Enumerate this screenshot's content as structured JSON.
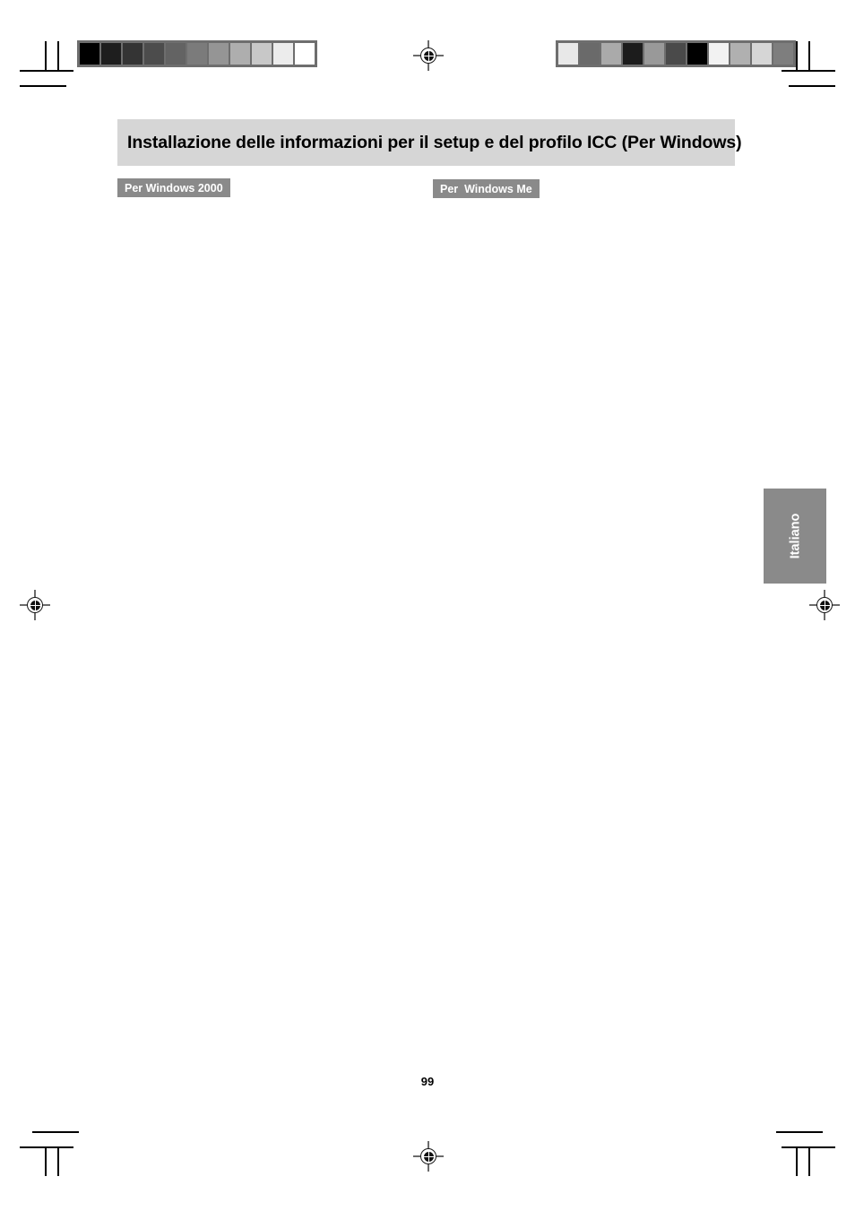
{
  "page": {
    "title": "Installazione delle informazioni per il setup e del profilo ICC (Per Windows)",
    "page_number": "99",
    "side_tab_label": "Italiano"
  },
  "sections": [
    {
      "id": "win2000",
      "label": "Per Windows 2000"
    },
    {
      "id": "winme",
      "label": "Per  Windows Me"
    }
  ],
  "print_marks": {
    "registration_icon": "registration-target-icon",
    "crop_mark_icon": "crop-mark-icon",
    "calibration_square_color": "#000000",
    "strip_border_color": "#6e6e6e",
    "left_strip": {
      "name": "grayscale-ramp",
      "patches": [
        "#000000",
        "#1e1e1e",
        "#343434",
        "#4c4c4c",
        "#636363",
        "#7b7b7b",
        "#959595",
        "#aeaeae",
        "#c8c8c8",
        "#ececec",
        "#ffffff"
      ]
    },
    "right_strip": {
      "name": "grayscale-scrambled",
      "patches": [
        "#e8e8e8",
        "#6a6a6a",
        "#aaaaaa",
        "#1c1c1c",
        "#999999",
        "#4a4a4a",
        "#000000",
        "#f2f2f2",
        "#b0b0b0",
        "#d6d6d6",
        "#7e7e7e"
      ]
    }
  },
  "colors": {
    "banner_bg": "#d6d6d6",
    "tag_bg": "#8a8a8a",
    "tag_text": "#ffffff",
    "text": "#000000"
  }
}
